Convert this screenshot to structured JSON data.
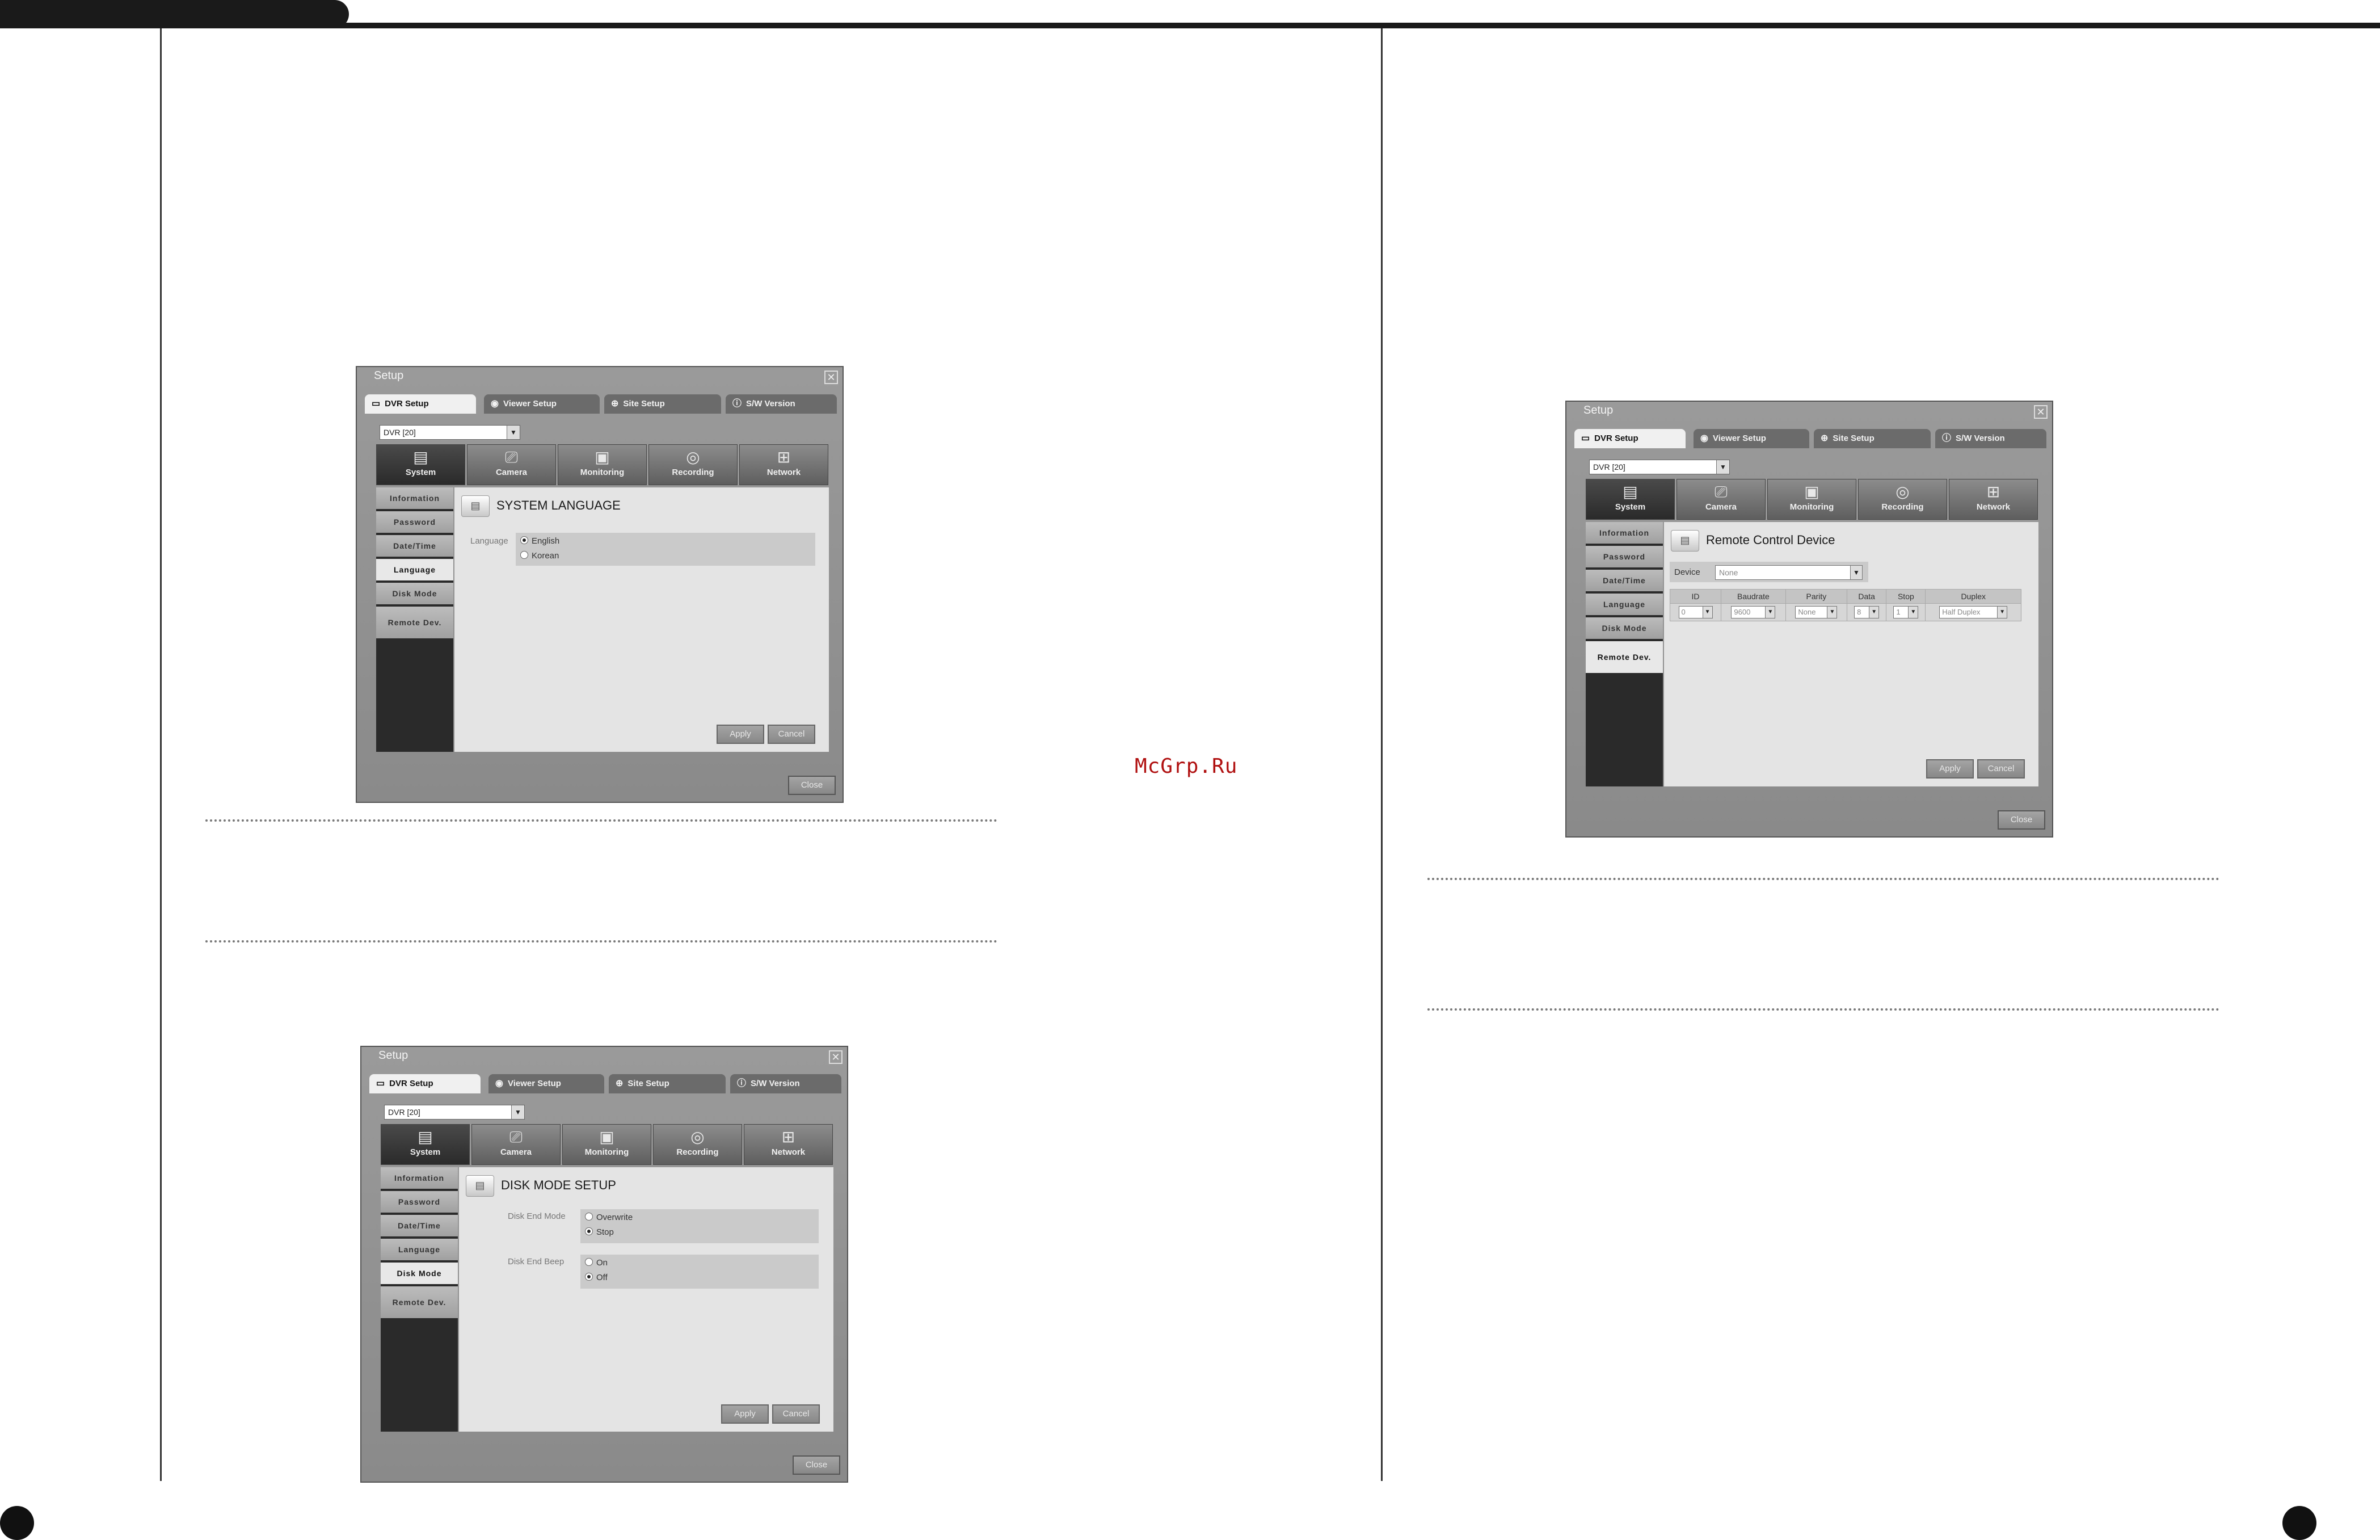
{
  "watermark": "McGrp.Ru",
  "windows": {
    "common": {
      "title": "Setup",
      "close_x": "✕",
      "tabs": [
        {
          "label": "DVR Setup",
          "icon": "dvr-icon"
        },
        {
          "label": "Viewer Setup",
          "icon": "viewer-icon"
        },
        {
          "label": "Site Setup",
          "icon": "site-icon"
        },
        {
          "label": "S/W Version",
          "icon": "info-icon"
        }
      ],
      "dvr_select": "DVR [20]",
      "categories": [
        "System",
        "Camera",
        "Monitoring",
        "Recording",
        "Network"
      ],
      "sidebar": [
        "Information",
        "Password",
        "Date/Time",
        "Language",
        "Disk Mode",
        "Remote Dev."
      ],
      "apply": "Apply",
      "cancel": "Cancel",
      "close": "Close"
    },
    "language": {
      "heading": "SYSTEM LANGUAGE",
      "label": "Language",
      "options": [
        "English",
        "Korean"
      ],
      "selected": "English"
    },
    "diskmode": {
      "heading": "DISK MODE SETUP",
      "end_mode_label": "Disk End Mode",
      "end_mode_options": [
        "Overwrite",
        "Stop"
      ],
      "end_mode_selected": "Stop",
      "beep_label": "Disk End Beep",
      "beep_options": [
        "On",
        "Off"
      ],
      "beep_selected": "Off"
    },
    "remote": {
      "heading": "Remote Control Device",
      "device_label": "Device",
      "device_value": "None",
      "columns": [
        "ID",
        "Baudrate",
        "Parity",
        "Data",
        "Stop",
        "Duplex"
      ],
      "row": [
        "0",
        "9600",
        "None",
        "8",
        "1",
        "Half Duplex"
      ]
    }
  }
}
